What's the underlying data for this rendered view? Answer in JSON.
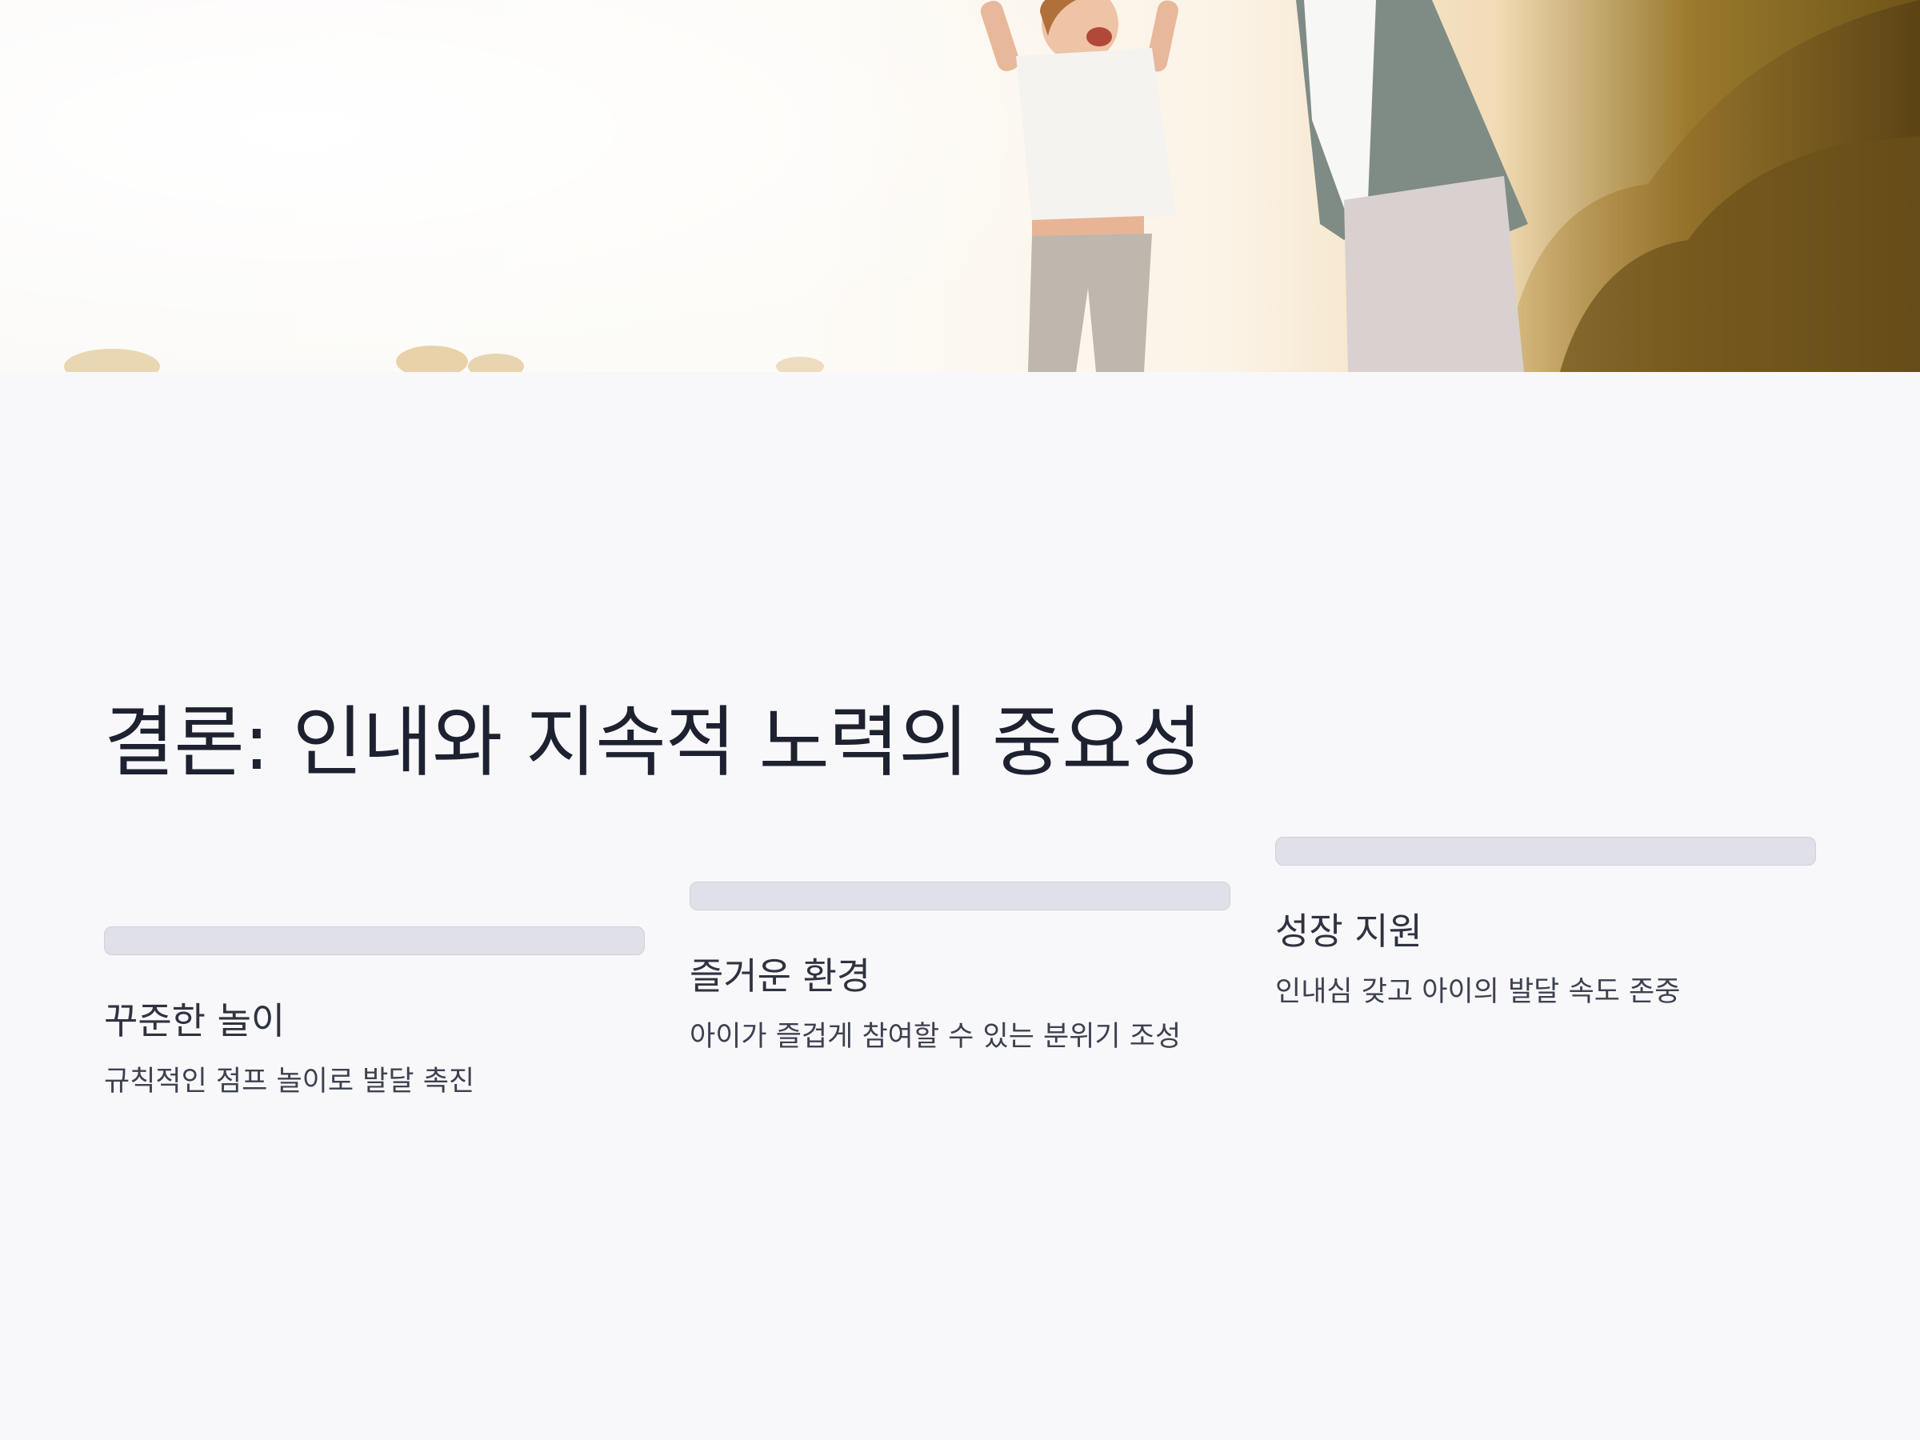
{
  "slide": {
    "title": "결론: 인내와 지속적 노력의 중요성"
  },
  "hero": {
    "image_alt": "jumping-parent-and-child-photo"
  },
  "cards": [
    {
      "title": "꾸준한 놀이",
      "description": "규칙적인 점프 놀이로 발달 촉진"
    },
    {
      "title": "즐거운 환경",
      "description": "아이가 즐겁게 참여할 수 있는 분위기 조성"
    },
    {
      "title": "성장 지원",
      "description": "인내심 갖고 아이의 발달 속도 존중"
    }
  ],
  "colors": {
    "background": "#f8f8fa",
    "title_text": "#1d2130",
    "card_bar": "#e0e0e8",
    "body_text": "#3d4150"
  }
}
